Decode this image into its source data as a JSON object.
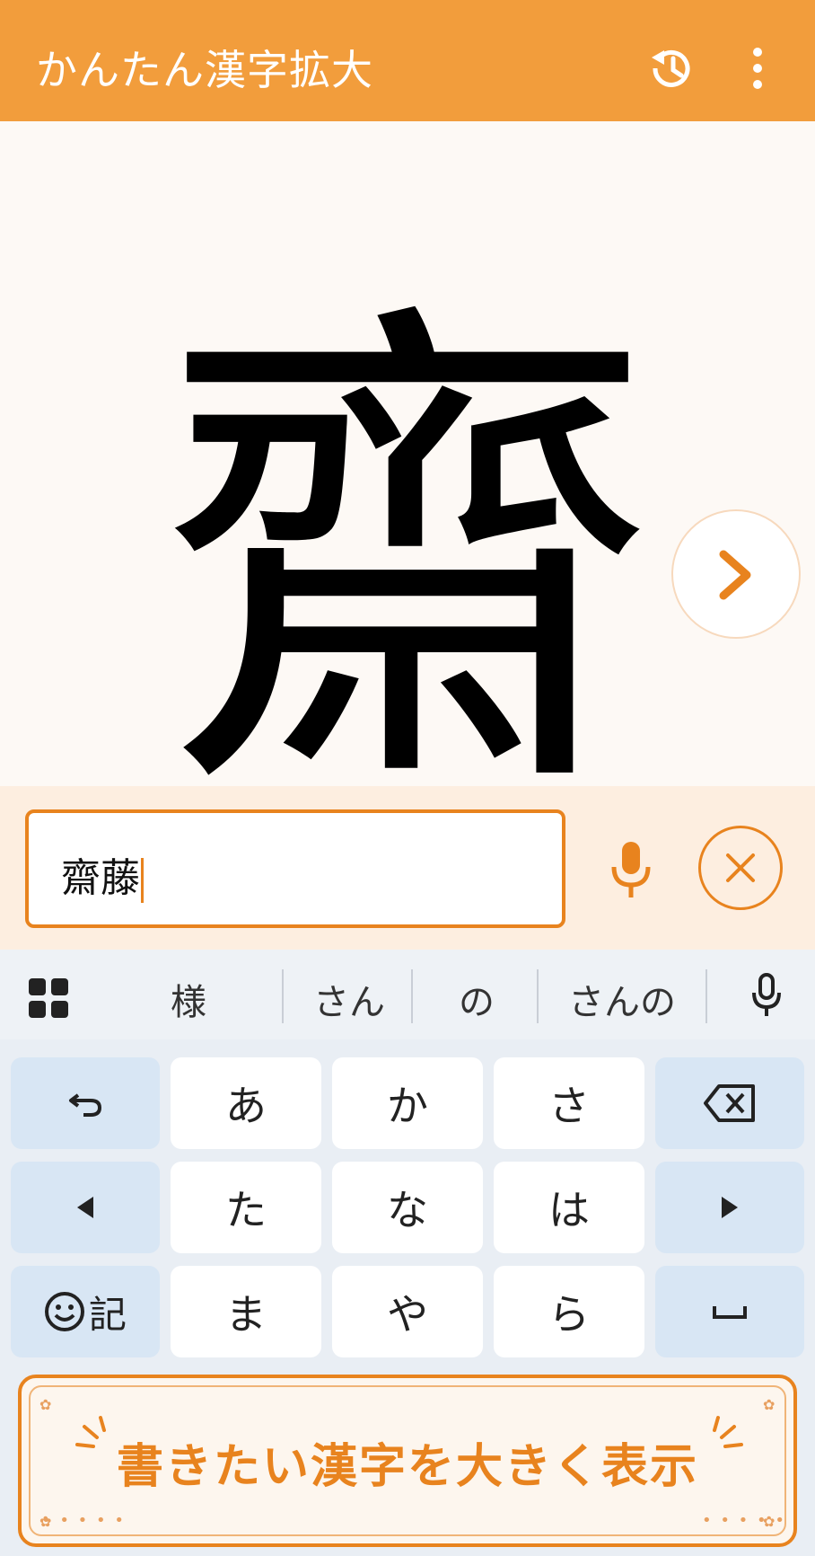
{
  "app": {
    "title": "かんたん漢字拡大"
  },
  "display": {
    "kanji": "齋"
  },
  "input": {
    "value": "齋藤"
  },
  "keyboard": {
    "suggestions": [
      "様",
      "さん",
      "の",
      "さんの"
    ],
    "rows": [
      [
        "あ",
        "か",
        "さ"
      ],
      [
        "た",
        "な",
        "は"
      ],
      [
        "ま",
        "や",
        "ら"
      ]
    ],
    "emoji_key": "記"
  },
  "banner": {
    "text": "書きたい漢字を大きく表示"
  },
  "colors": {
    "accent": "#f29d3c",
    "accent_dark": "#e8831e",
    "key_fn": "#d8e6f4"
  },
  "icons": [
    "history-icon",
    "more-vert-icon",
    "chevron-right-icon",
    "mic-icon",
    "clear-icon",
    "apps-grid-icon",
    "undo-icon",
    "backspace-icon",
    "arrow-left-icon",
    "arrow-right-icon",
    "emoji-icon",
    "space-icon"
  ]
}
